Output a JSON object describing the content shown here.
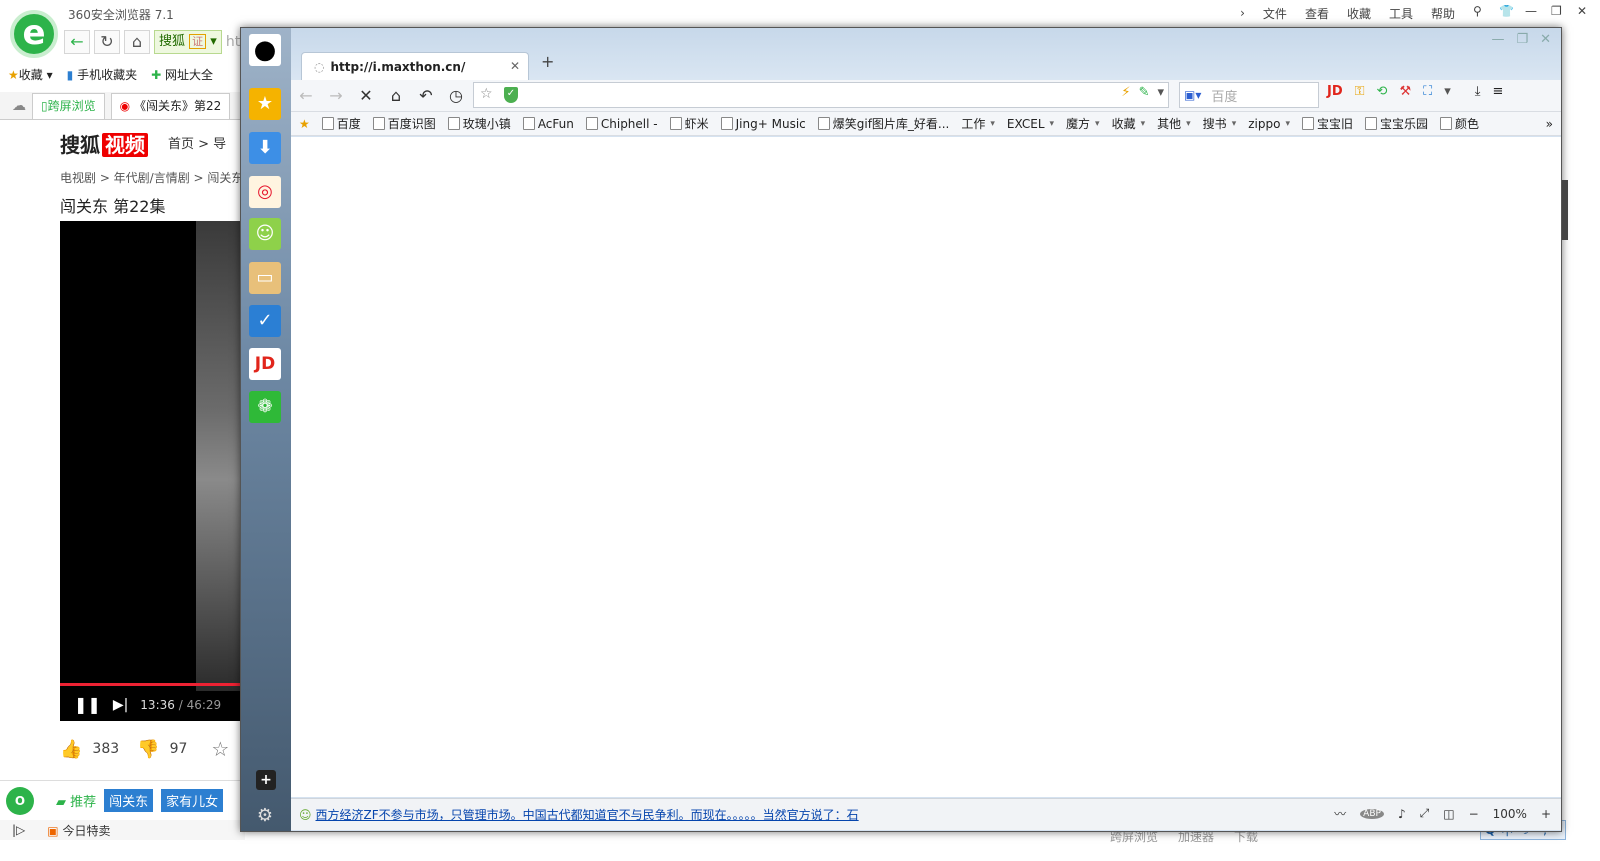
{
  "bg": {
    "app_title": "360安全浏览器 7.1",
    "menu": [
      "文件",
      "查看",
      "收藏",
      "工具",
      "帮助"
    ],
    "addr_tag": "搜狐",
    "addr_cert": "证",
    "addr_partial": "ht",
    "favs": [
      "收藏",
      "手机收藏夹",
      "网址大全"
    ],
    "tabs": [
      "跨屏浏览",
      "《闯关东》第22"
    ],
    "sohu_logo": "搜狐",
    "sohu_logo_badge": "视频",
    "sohu_nav": "首页 > 导",
    "crumb": "电视剧 > 年代剧/言情剧 > 闯关东",
    "video_title": "闯关东 第22集",
    "video_time": "13:36",
    "video_total": "/ 46:29",
    "likes": "383",
    "dislikes": "97",
    "bottom_recommend": "推荐",
    "bottom_tags": [
      "闯关东",
      "家有儿女"
    ],
    "status_today": "今日特卖",
    "tray": [
      "跨屏浏览",
      "加速器",
      "下载"
    ],
    "ime": [
      "中"
    ]
  },
  "mx": {
    "tab_url": "http://i.maxthon.cn/",
    "newtab_label": "+",
    "search_placeholder": "百度",
    "bookmarks": [
      {
        "label": "百度",
        "caret": false
      },
      {
        "label": "百度识图",
        "caret": false
      },
      {
        "label": "玫瑰小镇",
        "caret": false
      },
      {
        "label": "AcFun",
        "caret": false
      },
      {
        "label": "Chiphell -",
        "caret": false
      },
      {
        "label": "虾米",
        "caret": false
      },
      {
        "label": "Jing+ Music",
        "caret": false
      },
      {
        "label": "爆笑gif图片库_好看...",
        "caret": false
      },
      {
        "label": "工作",
        "caret": true
      },
      {
        "label": "EXCEL",
        "caret": true
      },
      {
        "label": "魔方",
        "caret": true
      },
      {
        "label": "收藏",
        "caret": true
      },
      {
        "label": "其他",
        "caret": true
      },
      {
        "label": "搜书",
        "caret": true
      },
      {
        "label": "zippo",
        "caret": true
      },
      {
        "label": "宝宝旧",
        "caret": false
      },
      {
        "label": "宝宝乐园",
        "caret": false
      },
      {
        "label": "颜色",
        "caret": false
      }
    ],
    "news": "西方经济ZF不参与市场，只管理市场。中国古代都知道官不与民争利。而现在。。。。。当然官方说了：石",
    "zoom": "100%",
    "sidebar_icons": [
      "avatar",
      "favorites-star",
      "download",
      "weibo",
      "smile",
      "notes",
      "reminder",
      "jd",
      "wechat"
    ],
    "colors": {
      "accent": "#2c7fd1",
      "sohu_red": "#e00000",
      "green": "#2db34a"
    }
  }
}
